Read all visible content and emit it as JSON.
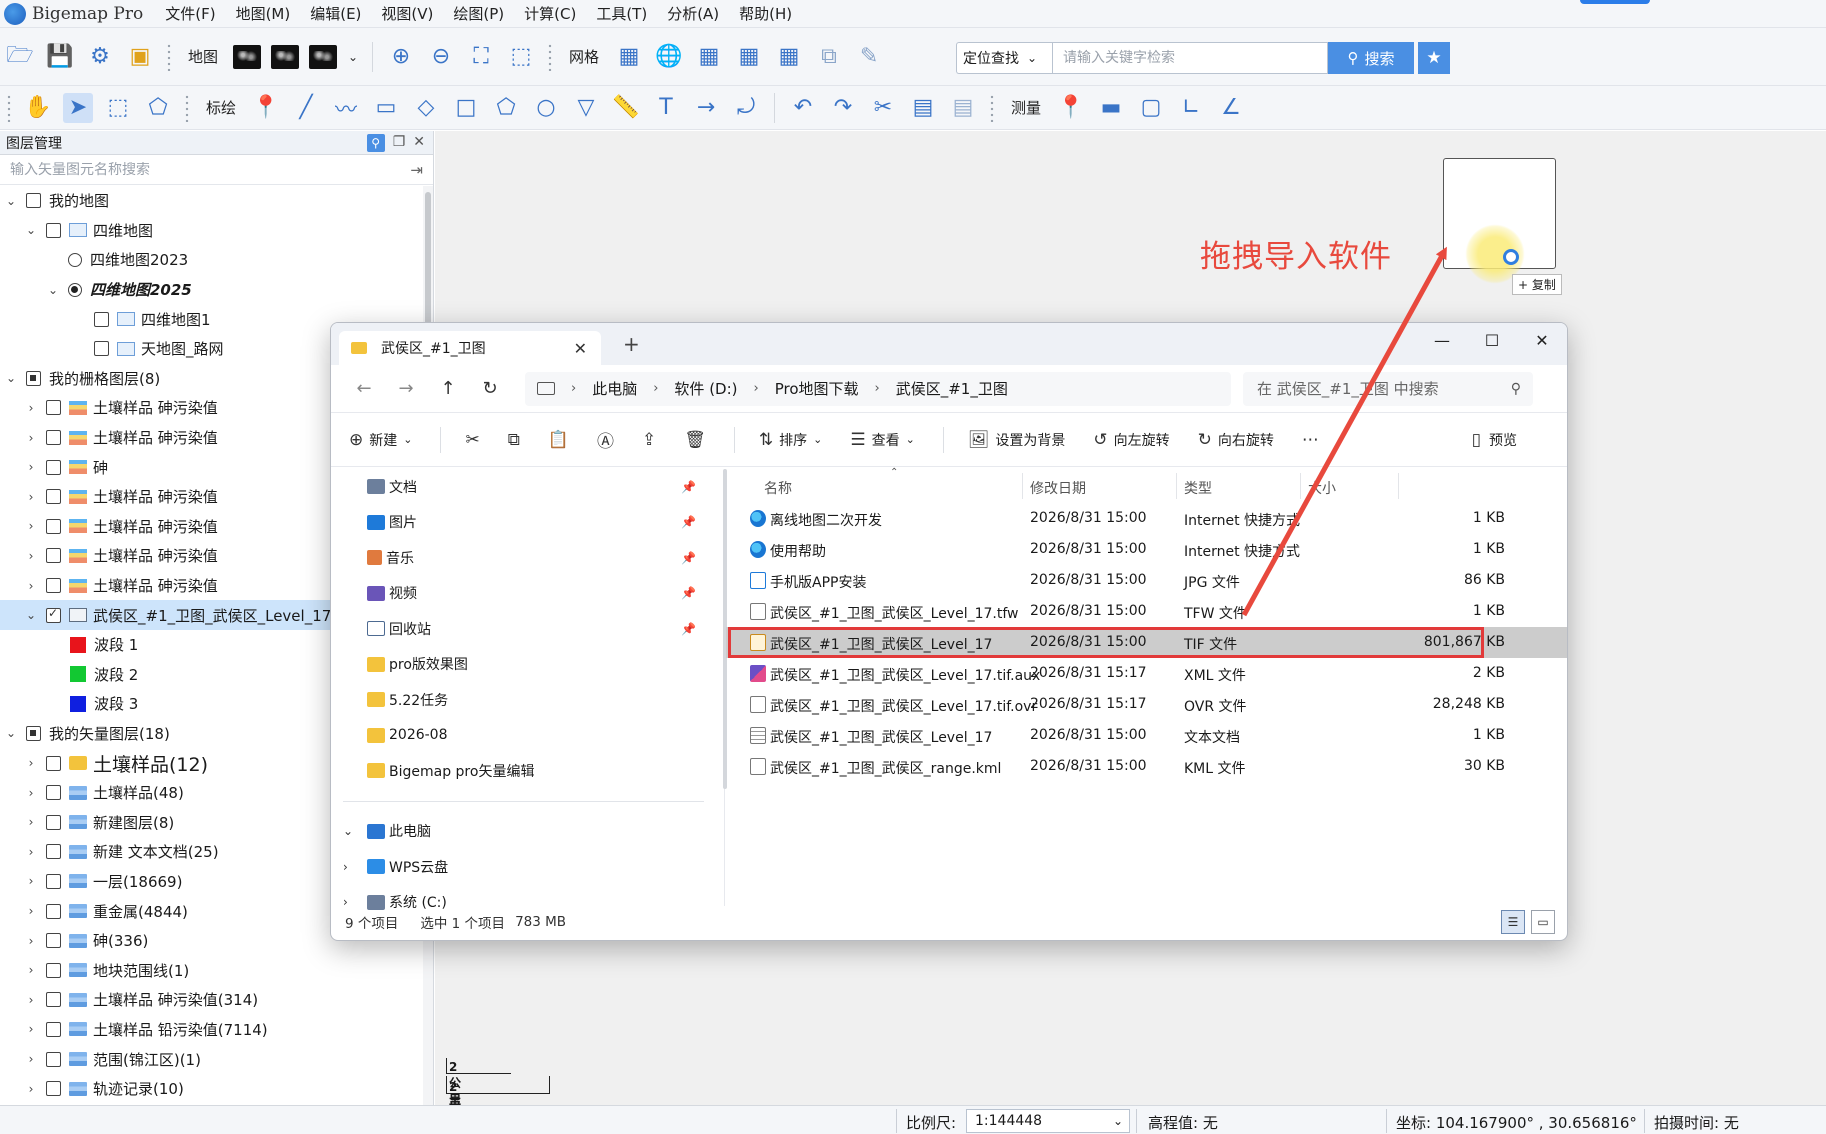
{
  "app": {
    "title": "Bigemap Pro",
    "menu": [
      "文件(F)",
      "地图(M)",
      "编辑(E)",
      "视图(V)",
      "绘图(P)",
      "计算(C)",
      "工具(T)",
      "分析(A)",
      "帮助(H)"
    ]
  },
  "toolbar1": {
    "map_label": "地图",
    "grid_label": "网格",
    "locate_select": "定位查找",
    "search_placeholder": "请输入关键字检索",
    "search_button": "搜索"
  },
  "toolbar2": {
    "draw_label": "标绘",
    "measure_label": "测量"
  },
  "layer_panel": {
    "title": "图层管理",
    "search_placeholder": "输入矢量图元名称搜索",
    "rows": [
      {
        "label": "我的地图"
      },
      {
        "label": "四维地图"
      },
      {
        "label": "四维地图2023"
      },
      {
        "label": "四维地图2025"
      },
      {
        "label": "四维地图1"
      },
      {
        "label": "天地图_路网"
      },
      {
        "label": "我的栅格图层(8)"
      },
      {
        "label": "土壤样品 砷污染值"
      },
      {
        "label": "土壤样品 砷污染值"
      },
      {
        "label": "砷"
      },
      {
        "label": "土壤样品 砷污染值"
      },
      {
        "label": "土壤样品 砷污染值"
      },
      {
        "label": "土壤样品 砷污染值"
      },
      {
        "label": "土壤样品 砷污染值"
      },
      {
        "label": "武侯区_#1_卫图_武侯区_Level_17"
      },
      {
        "label": "波段 1",
        "color": "#e8141b"
      },
      {
        "label": "波段 2",
        "color": "#12c832"
      },
      {
        "label": "波段 3",
        "color": "#0f1fe0"
      },
      {
        "label": "我的矢量图层(18)"
      },
      {
        "label": "土壤样品(12)"
      },
      {
        "label": "土壤样品(48)"
      },
      {
        "label": "新建图层(8)"
      },
      {
        "label": "新建 文本文档(25)"
      },
      {
        "label": "一层(18669)"
      },
      {
        "label": "重金属(4844)"
      },
      {
        "label": "砷(336)"
      },
      {
        "label": "地块范围线(1)"
      },
      {
        "label": "土壤样品 砷污染值(314)"
      },
      {
        "label": "土壤样品 铅污染值(7114)"
      },
      {
        "label": "范围(锦江区)(1)"
      },
      {
        "label": "轨迹记录(10)"
      }
    ]
  },
  "map": {
    "annotation": "拖拽导入软件",
    "copy_tip": "+ 复制",
    "scale_top": "2公里",
    "scale_bottom": "2英里",
    "accent": "#e8493d"
  },
  "statusbar": {
    "scale_label": "比例尺:",
    "scale_value": "1:144448",
    "elevation": "高程值: 无",
    "coords": "坐标: 104.167900° , 30.656816°",
    "capture_time": "拍摄时间: 无"
  },
  "explorer": {
    "tab_title": "武侯区_#1_卫图",
    "breadcrumb": [
      "此电脑",
      "软件 (D:)",
      "Pro地图下载",
      "武侯区_#1_卫图"
    ],
    "search_placeholder": "在 武侯区_#1_卫图 中搜索",
    "commands": {
      "new": "新建",
      "sort": "排序",
      "view": "查看",
      "set_bg": "设置为背景",
      "rotate_left": "向左旋转",
      "rotate_right": "向右旋转",
      "preview": "预览"
    },
    "nav": [
      {
        "label": "文档",
        "icon": "ico-doc",
        "pinned": true
      },
      {
        "label": "图片",
        "icon": "ico-pic",
        "pinned": true
      },
      {
        "label": "音乐",
        "icon": "ico-music",
        "pinned": true
      },
      {
        "label": "视频",
        "icon": "ico-video",
        "pinned": true
      },
      {
        "label": "回收站",
        "icon": "ico-bin",
        "pinned": true
      },
      {
        "label": "pro版效果图",
        "icon": "ico-folder",
        "pinned": false
      },
      {
        "label": "5.22任务",
        "icon": "ico-folder",
        "pinned": false
      },
      {
        "label": "2026-08",
        "icon": "ico-folder",
        "pinned": false
      },
      {
        "label": "Bigemap pro矢量编辑",
        "icon": "ico-folder",
        "pinned": false
      }
    ],
    "nav_tree": [
      {
        "label": "此电脑",
        "icon": "ico-pc",
        "expand": "⌄"
      },
      {
        "label": "WPS云盘",
        "icon": "ico-cloud",
        "expand": "›"
      },
      {
        "label": "系统 (C:)",
        "icon": "ico-sys",
        "expand": "›"
      }
    ],
    "columns": {
      "name": "名称",
      "date": "修改日期",
      "type": "类型",
      "size": "大小"
    },
    "files": [
      {
        "name": "离线地图二次开发",
        "date": "2026/8/31 15:00",
        "type": "Internet 快捷方式",
        "size": "1 KB",
        "icon": "f-edge"
      },
      {
        "name": "使用帮助",
        "date": "2026/8/31 15:00",
        "type": "Internet 快捷方式",
        "size": "1 KB",
        "icon": "f-edge"
      },
      {
        "name": "手机版APP安装",
        "date": "2026/8/31 15:00",
        "type": "JPG 文件",
        "size": "86 KB",
        "icon": "f-jpg"
      },
      {
        "name": "武侯区_#1_卫图_武侯区_Level_17.tfw",
        "date": "2026/8/31 15:00",
        "type": "TFW 文件",
        "size": "1 KB",
        "icon": "f-blank"
      },
      {
        "name": "武侯区_#1_卫图_武侯区_Level_17",
        "date": "2026/8/31 15:00",
        "type": "TIF 文件",
        "size": "801,867 KB",
        "icon": "f-tif",
        "selected": true
      },
      {
        "name": "武侯区_#1_卫图_武侯区_Level_17.tif.aux",
        "date": "2026/8/31 15:17",
        "type": "XML 文件",
        "size": "2 KB",
        "icon": "f-aux"
      },
      {
        "name": "武侯区_#1_卫图_武侯区_Level_17.tif.ovr",
        "date": "2026/8/31 15:17",
        "type": "OVR 文件",
        "size": "28,248 KB",
        "icon": "f-blank"
      },
      {
        "name": "武侯区_#1_卫图_武侯区_Level_17",
        "date": "2026/8/31 15:00",
        "type": "文本文档",
        "size": "1 KB",
        "icon": "f-txt"
      },
      {
        "name": "武侯区_#1_卫图_武侯区_range.kml",
        "date": "2026/8/31 15:00",
        "type": "KML 文件",
        "size": "30 KB",
        "icon": "f-blank"
      }
    ],
    "status": {
      "count": "9 个项目",
      "selected": "选中 1 个项目",
      "size": "783 MB"
    }
  }
}
